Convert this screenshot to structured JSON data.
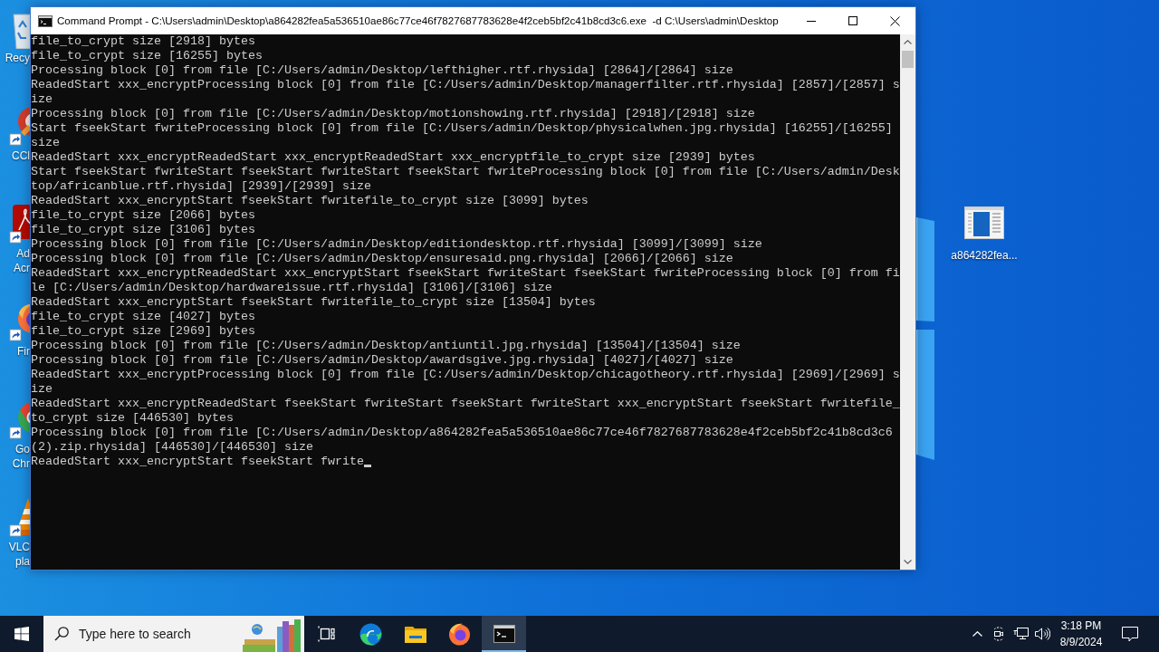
{
  "desktop": {
    "icons": [
      {
        "kind": "recycle-bin",
        "label_lines": [
          "Recy"
        ]
      },
      {
        "kind": "ccleaner",
        "label_lines": [
          "CCl"
        ]
      },
      {
        "kind": "acrobat",
        "label_lines": [
          "Ad",
          "Acr"
        ]
      },
      {
        "kind": "firefox",
        "label_lines": [
          "Fir"
        ]
      },
      {
        "kind": "chrome",
        "label_lines": [
          "Go",
          "Chr"
        ]
      },
      {
        "kind": "vlc",
        "label_lines": [
          "VLC",
          "pla"
        ]
      }
    ],
    "file_icons": [
      {
        "label": "a864282fea..."
      }
    ]
  },
  "window": {
    "title": "Command Prompt - C:\\Users\\admin\\Desktop\\a864282fea5a536510ae86c77ce46f7827687783628e4f2ceb5bf2c41b8cd3c6.exe  -d C:\\Users\\admin\\Desktop",
    "console": {
      "cursor": true,
      "lines": [
        "file_to_crypt size [2918] bytes",
        "file_to_crypt size [16255] bytes",
        "Processing block [0] from file [C:/Users/admin/Desktop/lefthigher.rtf.rhysida] [2864]/[2864] size",
        "ReadedStart xxx_encryptProcessing block [0] from file [C:/Users/admin/Desktop/managerfilter.rtf.rhysida] [2857]/[2857] s",
        "ize",
        "Processing block [0] from file [C:/Users/admin/Desktop/motionshowing.rtf.rhysida] [2918]/[2918] size",
        "Start fseekStart fwriteProcessing block [0] from file [C:/Users/admin/Desktop/physicalwhen.jpg.rhysida] [16255]/[16255]",
        "size",
        "ReadedStart xxx_encryptReadedStart xxx_encryptReadedStart xxx_encryptfile_to_crypt size [2939] bytes",
        "Start fseekStart fwriteStart fseekStart fwriteStart fseekStart fwriteProcessing block [0] from file [C:/Users/admin/Desk",
        "top/africanblue.rtf.rhysida] [2939]/[2939] size",
        "ReadedStart xxx_encryptStart fseekStart fwritefile_to_crypt size [3099] bytes",
        "file_to_crypt size [2066] bytes",
        "file_to_crypt size [3106] bytes",
        "Processing block [0] from file [C:/Users/admin/Desktop/editiondesktop.rtf.rhysida] [3099]/[3099] size",
        "Processing block [0] from file [C:/Users/admin/Desktop/ensuresaid.png.rhysida] [2066]/[2066] size",
        "ReadedStart xxx_encryptReadedStart xxx_encryptStart fseekStart fwriteStart fseekStart fwriteProcessing block [0] from fi",
        "le [C:/Users/admin/Desktop/hardwareissue.rtf.rhysida] [3106]/[3106] size",
        "ReadedStart xxx_encryptStart fseekStart fwritefile_to_crypt size [13504] bytes",
        "file_to_crypt size [4027] bytes",
        "file_to_crypt size [2969] bytes",
        "Processing block [0] from file [C:/Users/admin/Desktop/antiuntil.jpg.rhysida] [13504]/[13504] size",
        "Processing block [0] from file [C:/Users/admin/Desktop/awardsgive.jpg.rhysida] [4027]/[4027] size",
        "ReadedStart xxx_encryptProcessing block [0] from file [C:/Users/admin/Desktop/chicagotheory.rtf.rhysida] [2969]/[2969] s",
        "ize",
        "ReadedStart xxx_encryptReadedStart fseekStart fwriteStart fseekStart fwriteStart xxx_encryptStart fseekStart fwritefile_",
        "to_crypt size [446530] bytes",
        "Processing block [0] from file [C:/Users/admin/Desktop/a864282fea5a536510ae86c77ce46f7827687783628e4f2ceb5bf2c41b8cd3c6",
        "(2).zip.rhysida] [446530]/[446530] size",
        "ReadedStart xxx_encryptStart fseekStart fwrite"
      ]
    }
  },
  "taskbar": {
    "search": {
      "placeholder": "Type here to search"
    },
    "apps": [
      {
        "kind": "task-view",
        "selected": false
      },
      {
        "kind": "edge",
        "selected": false
      },
      {
        "kind": "explorer",
        "selected": false
      },
      {
        "kind": "firefox",
        "selected": false
      },
      {
        "kind": "cmd",
        "selected": true
      }
    ],
    "clock": {
      "time": "3:18 PM",
      "date": "8/9/2024"
    }
  }
}
